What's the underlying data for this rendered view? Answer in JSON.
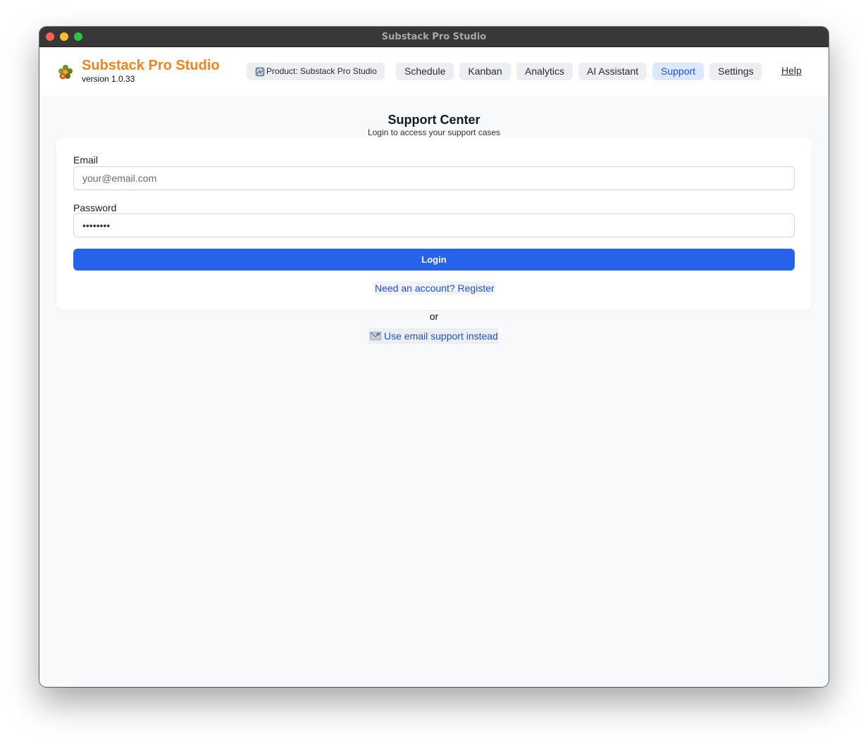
{
  "window": {
    "title": "Substack Pro Studio"
  },
  "brand": {
    "name": "Substack Pro Studio",
    "version": "version 1.0.33",
    "icon": "flower-logo-icon"
  },
  "nav": {
    "product": {
      "label": "Product: Substack Pro Studio",
      "icon": "refresh-icon"
    },
    "items": [
      {
        "label": "Schedule",
        "active": false
      },
      {
        "label": "Kanban",
        "active": false
      },
      {
        "label": "Analytics",
        "active": false
      },
      {
        "label": "AI Assistant",
        "active": false
      },
      {
        "label": "Support",
        "active": true
      },
      {
        "label": "Settings",
        "active": false
      }
    ],
    "help": "Help"
  },
  "support": {
    "title": "Support Center",
    "subtitle": "Login to access your support cases",
    "email": {
      "label": "Email",
      "placeholder": "your@email.com",
      "value": ""
    },
    "password": {
      "label": "Password",
      "value": "password"
    },
    "login_label": "Login",
    "register_link": "Need an account? Register",
    "or": "or",
    "email_support": {
      "label": "Use email support instead",
      "icon": "envelope-icon"
    }
  },
  "colors": {
    "brand": "#f5821f",
    "primary": "#2563eb",
    "link": "#1d4ed8",
    "active_tab_bg": "#dbe8fd"
  }
}
